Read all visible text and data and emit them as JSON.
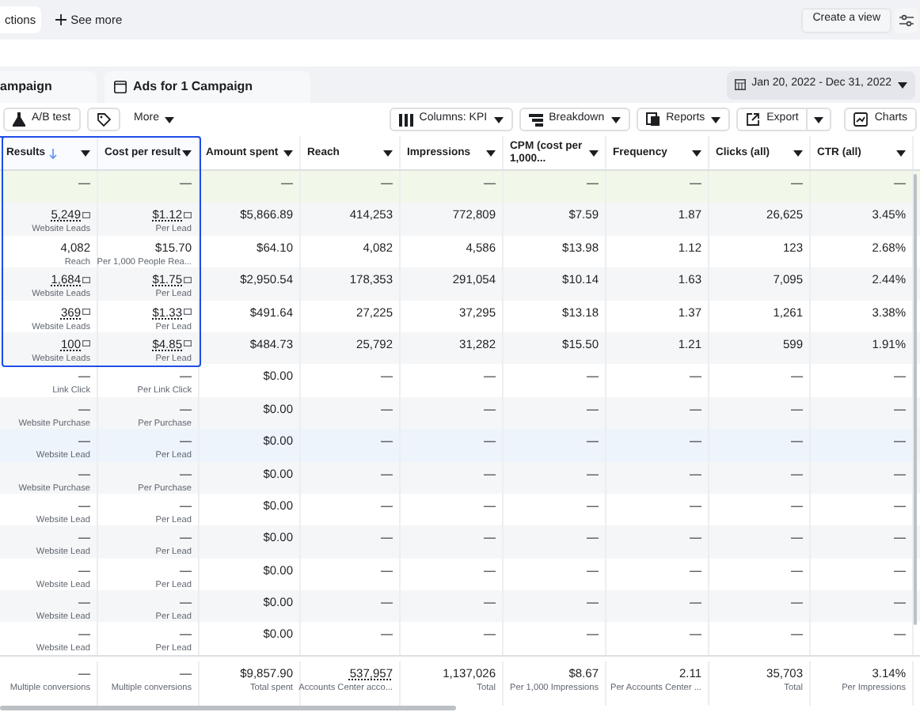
{
  "top_bar": {
    "tab": "ctions",
    "see_more": "See more",
    "create_view": "Create a view"
  },
  "tabs": [
    {
      "label": "ampaign",
      "icon": false
    },
    {
      "label": "Ads for 1 Campaign",
      "icon": true
    }
  ],
  "date_range": "Jan 20, 2022 - Dec 31, 2022",
  "toolbar": {
    "left": [
      {
        "kind": "ab",
        "label": "A/B test"
      },
      {
        "kind": "tag"
      },
      {
        "kind": "more",
        "label": "More"
      }
    ],
    "right": [
      {
        "kind": "columns",
        "label": "Columns: KPI"
      },
      {
        "kind": "breakdown",
        "label": "Breakdown"
      },
      {
        "kind": "reports",
        "label": "Reports"
      },
      {
        "kind": "export",
        "label": "Export"
      },
      {
        "kind": "charts",
        "label": "Charts"
      }
    ]
  },
  "columns": [
    {
      "label": "Results",
      "sorted": true,
      "selected": true
    },
    {
      "label": "Cost per result",
      "sorted": false,
      "selected": true
    },
    {
      "label": "Amount spent",
      "sorted": false,
      "selected": false
    },
    {
      "label": "Reach",
      "sorted": false,
      "selected": false
    },
    {
      "label": "Impressions",
      "sorted": false,
      "selected": false
    },
    {
      "label": "CPM (cost per 1,000...",
      "sorted": false,
      "selected": false
    },
    {
      "label": "Frequency",
      "sorted": false,
      "selected": false
    },
    {
      "label": "Clicks (all)",
      "sorted": false,
      "selected": false
    },
    {
      "label": "CTR (all)",
      "sorted": false,
      "selected": false
    }
  ],
  "rows": [
    {
      "kind": "new",
      "cells": [
        {
          "value": "—"
        },
        {
          "value": "—"
        },
        {
          "value": "—"
        },
        {
          "value": "—"
        },
        {
          "value": "—"
        },
        {
          "value": "—"
        },
        {
          "value": "—"
        },
        {
          "value": "—"
        },
        {
          "value": "—"
        }
      ]
    },
    {
      "kind": "result",
      "cells": [
        {
          "value": "5,249",
          "sub": "Website Leads",
          "info": true
        },
        {
          "value": "$1.12",
          "sub": "Per Lead",
          "info": true
        },
        {
          "value": "$5,866.89"
        },
        {
          "value": "414,253"
        },
        {
          "value": "772,809"
        },
        {
          "value": "$7.59"
        },
        {
          "value": "1.87"
        },
        {
          "value": "26,625"
        },
        {
          "value": "3.45%"
        }
      ]
    },
    {
      "kind": "result",
      "cells": [
        {
          "value": "4,082",
          "sub": "Reach"
        },
        {
          "value": "$15.70",
          "sub": "Per 1,000 People Rea..."
        },
        {
          "value": "$64.10"
        },
        {
          "value": "4,082"
        },
        {
          "value": "4,586"
        },
        {
          "value": "$13.98"
        },
        {
          "value": "1.12"
        },
        {
          "value": "123"
        },
        {
          "value": "2.68%"
        }
      ]
    },
    {
      "kind": "result",
      "cells": [
        {
          "value": "1,684",
          "sub": "Website Leads",
          "info": true
        },
        {
          "value": "$1.75",
          "sub": "Per Lead",
          "info": true
        },
        {
          "value": "$2,950.54"
        },
        {
          "value": "178,353"
        },
        {
          "value": "291,054"
        },
        {
          "value": "$10.14"
        },
        {
          "value": "1.63"
        },
        {
          "value": "7,095"
        },
        {
          "value": "2.44%"
        }
      ]
    },
    {
      "kind": "result",
      "cells": [
        {
          "value": "369",
          "sub": "Website Leads",
          "info": true
        },
        {
          "value": "$1.33",
          "sub": "Per Lead",
          "info": true
        },
        {
          "value": "$491.64"
        },
        {
          "value": "27,225"
        },
        {
          "value": "37,295"
        },
        {
          "value": "$13.18"
        },
        {
          "value": "1.37"
        },
        {
          "value": "1,261"
        },
        {
          "value": "3.38%"
        }
      ]
    },
    {
      "kind": "result",
      "cells": [
        {
          "value": "100",
          "sub": "Website Leads",
          "info": true
        },
        {
          "value": "$4.85",
          "sub": "Per Lead",
          "info": true
        },
        {
          "value": "$484.73"
        },
        {
          "value": "25,792"
        },
        {
          "value": "31,282"
        },
        {
          "value": "$15.50"
        },
        {
          "value": "1.21"
        },
        {
          "value": "599"
        },
        {
          "value": "1.91%"
        }
      ]
    },
    {
      "kind": "empty",
      "cells": [
        {
          "value": "—",
          "sub": "Link Click"
        },
        {
          "value": "—",
          "sub": "Per Link Click"
        },
        {
          "value": "$0.00"
        },
        {
          "value": "—"
        },
        {
          "value": "—"
        },
        {
          "value": "—"
        },
        {
          "value": "—"
        },
        {
          "value": "—"
        },
        {
          "value": "—"
        }
      ]
    },
    {
      "kind": "empty",
      "cells": [
        {
          "value": "—",
          "sub": "Website Purchase"
        },
        {
          "value": "—",
          "sub": "Per Purchase"
        },
        {
          "value": "$0.00"
        },
        {
          "value": "—"
        },
        {
          "value": "—"
        },
        {
          "value": "—"
        },
        {
          "value": "—"
        },
        {
          "value": "—"
        },
        {
          "value": "—"
        }
      ]
    },
    {
      "kind": "hover",
      "cells": [
        {
          "value": "—",
          "sub": "Website Lead"
        },
        {
          "value": "—",
          "sub": "Per Lead"
        },
        {
          "value": "$0.00"
        },
        {
          "value": "—"
        },
        {
          "value": "—"
        },
        {
          "value": "—"
        },
        {
          "value": "—"
        },
        {
          "value": "—"
        },
        {
          "value": "—"
        }
      ]
    },
    {
      "kind": "empty",
      "cells": [
        {
          "value": "—",
          "sub": "Website Purchase"
        },
        {
          "value": "—",
          "sub": "Per Purchase"
        },
        {
          "value": "$0.00"
        },
        {
          "value": "—"
        },
        {
          "value": "—"
        },
        {
          "value": "—"
        },
        {
          "value": "—"
        },
        {
          "value": "—"
        },
        {
          "value": "—"
        }
      ]
    },
    {
      "kind": "empty",
      "cells": [
        {
          "value": "—",
          "sub": "Website Lead"
        },
        {
          "value": "—",
          "sub": "Per Lead"
        },
        {
          "value": "$0.00"
        },
        {
          "value": "—"
        },
        {
          "value": "—"
        },
        {
          "value": "—"
        },
        {
          "value": "—"
        },
        {
          "value": "—"
        },
        {
          "value": "—"
        }
      ]
    },
    {
      "kind": "empty",
      "cells": [
        {
          "value": "—",
          "sub": "Website Lead"
        },
        {
          "value": "—",
          "sub": "Per Lead"
        },
        {
          "value": "$0.00"
        },
        {
          "value": "—"
        },
        {
          "value": "—"
        },
        {
          "value": "—"
        },
        {
          "value": "—"
        },
        {
          "value": "—"
        },
        {
          "value": "—"
        }
      ]
    },
    {
      "kind": "empty",
      "cells": [
        {
          "value": "—",
          "sub": "Website Lead"
        },
        {
          "value": "—",
          "sub": "Per Lead"
        },
        {
          "value": "$0.00"
        },
        {
          "value": "—"
        },
        {
          "value": "—"
        },
        {
          "value": "—"
        },
        {
          "value": "—"
        },
        {
          "value": "—"
        },
        {
          "value": "—"
        }
      ]
    },
    {
      "kind": "empty",
      "cells": [
        {
          "value": "—",
          "sub": "Website Lead"
        },
        {
          "value": "—",
          "sub": "Per Lead"
        },
        {
          "value": "$0.00"
        },
        {
          "value": "—"
        },
        {
          "value": "—"
        },
        {
          "value": "—"
        },
        {
          "value": "—"
        },
        {
          "value": "—"
        },
        {
          "value": "—"
        }
      ]
    },
    {
      "kind": "empty",
      "cells": [
        {
          "value": "—",
          "sub": "Website Lead"
        },
        {
          "value": "—",
          "sub": "Per Lead"
        },
        {
          "value": "$0.00"
        },
        {
          "value": "—"
        },
        {
          "value": "—"
        },
        {
          "value": "—"
        },
        {
          "value": "—"
        },
        {
          "value": "—"
        },
        {
          "value": "—"
        }
      ]
    }
  ],
  "totals": [
    {
      "value": "—",
      "sub": "Multiple conversions"
    },
    {
      "value": "—",
      "sub": "Multiple conversions"
    },
    {
      "value": "$9,857.90",
      "sub": "Total spent"
    },
    {
      "value": "537,957",
      "sub": "Accounts Center acco...",
      "linked": true
    },
    {
      "value": "1,137,026",
      "sub": "Total"
    },
    {
      "value": "$8.67",
      "sub": "Per 1,000 Impressions"
    },
    {
      "value": "2.11",
      "sub": "Per Accounts Center ..."
    },
    {
      "value": "35,703",
      "sub": "Total"
    },
    {
      "value": "3.14%",
      "sub": "Per Impressions"
    }
  ]
}
